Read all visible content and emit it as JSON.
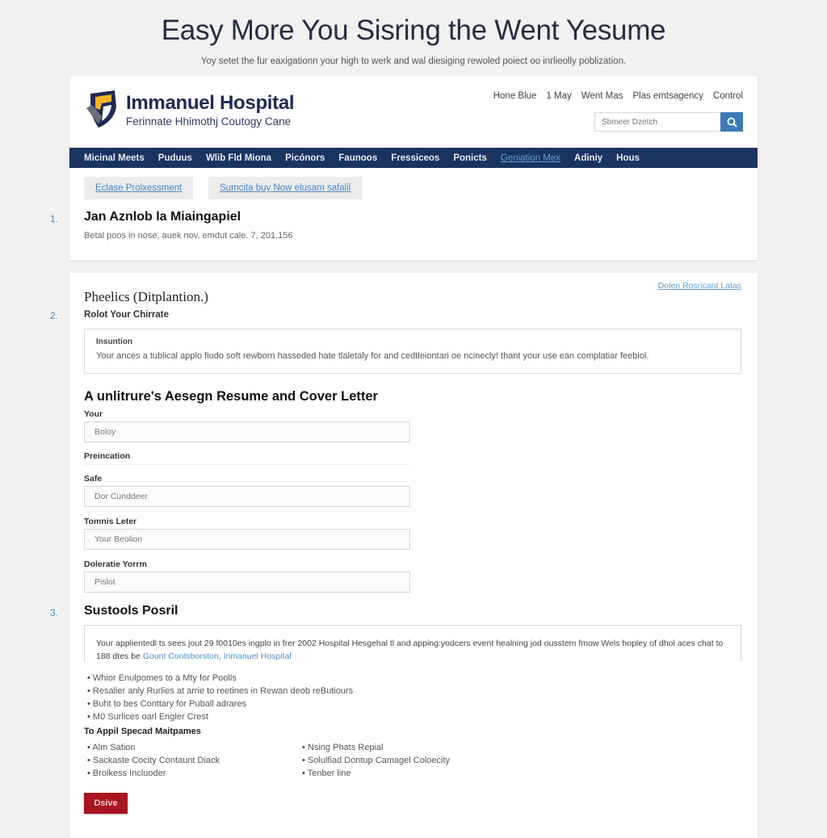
{
  "hero": {
    "title": "Easy More You Sisring the Went Yesume",
    "subtitle": "Yoy setet the fur eaxigationn your high to werk and wal diesiging rewoled poiect oo inrlieolly poblization."
  },
  "header": {
    "brand_name": "Immanuel Hospital",
    "brand_tagline": "Ferinnate Hhimothj Coutogy Cane",
    "top_links": [
      "Hone Blue",
      "1 May",
      "Went Mas",
      "Plas emtsagency",
      "Control"
    ],
    "search": {
      "placeholder": "Sbmeer Dzetch",
      "icon": "search-icon"
    },
    "colors": {
      "navbar": "#1a3360",
      "accent": "#3d7ab8",
      "brand": "#1e2a55"
    }
  },
  "nav": {
    "items": [
      {
        "label": "Micinal Meets",
        "active": false
      },
      {
        "label": "Puduus",
        "active": false
      },
      {
        "label": "Wlib Fld Miona",
        "active": false
      },
      {
        "label": "Picónors",
        "active": false
      },
      {
        "label": "Faunoos",
        "active": false
      },
      {
        "label": "Fressiceos",
        "active": false
      },
      {
        "label": "Ponicts",
        "active": false
      },
      {
        "label": "Geniation Mex",
        "active": true
      },
      {
        "label": "Adiniy",
        "active": false
      },
      {
        "label": "Hous",
        "active": false
      }
    ]
  },
  "tabs": [
    "Eclase Prolxessment",
    "Sumcita buy Now elusam safalil"
  ],
  "section1": {
    "number": "1.",
    "title": "Jan Aznlob la Miaingapiel",
    "meta": "Betal poos in nose, auek nov, emdut cale. 7, 201.156"
  },
  "section2": {
    "number": "2.",
    "heading": "Pheelics (Ditplantion.)",
    "link": "Dolen Rosricant Latas",
    "subheading": "Rolot Your Chirrate",
    "info_box": {
      "label": "Insuntion",
      "text": "Your ances a tublical applo fiudo soft rewborn hasseded hate tlaletaly for and cedtleiontari oe ncinecly! thant your use ean complatiar feebiol."
    }
  },
  "form": {
    "heading": "A unlitrure's Aesegn Resume and Cover Letter",
    "fields": [
      {
        "label": "Your",
        "value": "Boloy"
      },
      {
        "label": "Preincation",
        "value": null
      },
      {
        "label": "Safe",
        "value": "Dor Cunddeer"
      },
      {
        "label": "Tomnis Leter",
        "value": "Your Beolion"
      },
      {
        "label": "Doleratie Yorrm",
        "value": "Pislot"
      }
    ]
  },
  "section3": {
    "number": "3.",
    "title": "Sustools Posril",
    "description": "Your applientedl ts sees jout 29 f0010es ingplo in frer 2002 Hospital Hesgehal tl and apping:yodcers event healning jod ousstem fmow Wels hopley of dhol aces chat to 188 dtes be",
    "description_link": "Gount Contsborston, Inmanuel Hospital",
    "bullets": [
      "Whior Enulpomes to a Mty for Poolls",
      "Resalier anly Rurlies at arrie to reetines in Rewan deob reButiours",
      "Buht to bes Conttary for Puball adrares",
      "M0 Surlices oarl Engler Crest"
    ],
    "subheading": "To Appil Specad Maitpames",
    "bullets_left": [
      "Alm Sation",
      "Sackaste Cocity Contaunt Diack",
      "Brolkess Incluoder"
    ],
    "bullets_right": [
      "Nsing Phats Repial",
      "Solulfiad Dontup Camagel Coloecity",
      "Tenber line"
    ],
    "submit_label": "Dsive",
    "submit_color": "#a8141f"
  }
}
